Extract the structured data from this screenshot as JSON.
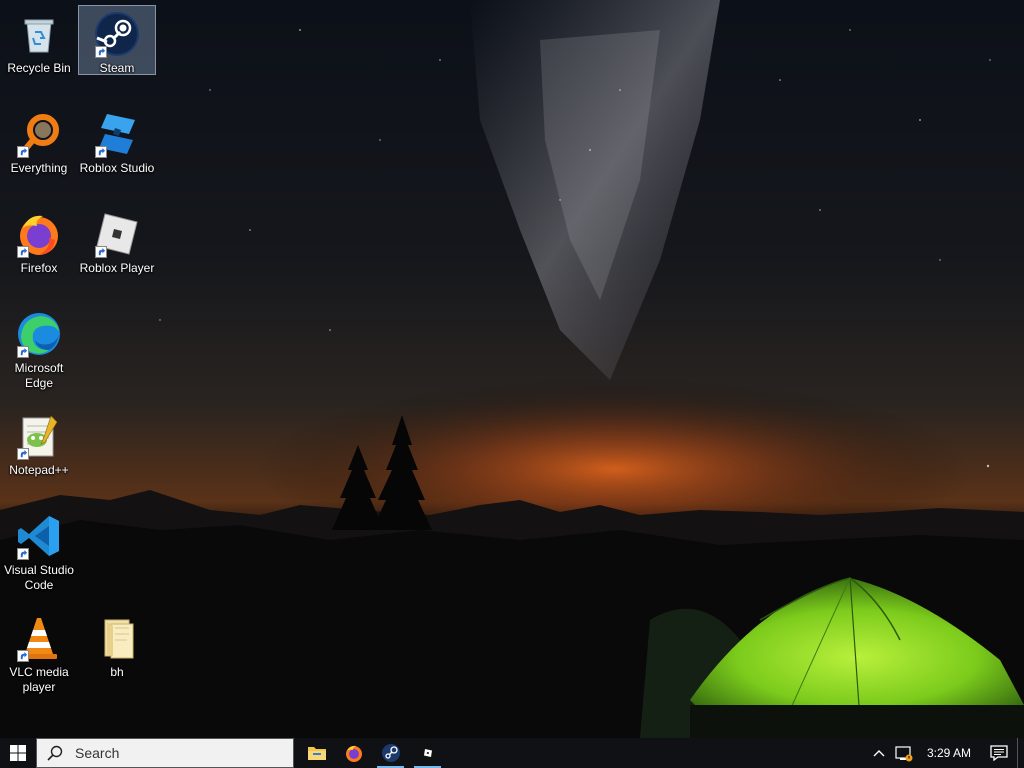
{
  "desktop": {
    "icons": [
      {
        "name": "recycle-bin",
        "label": "Recycle Bin",
        "selected": false,
        "shortcut": false
      },
      {
        "name": "steam",
        "label": "Steam",
        "selected": true,
        "shortcut": true
      },
      {
        "name": "everything",
        "label": "Everything",
        "selected": false,
        "shortcut": true
      },
      {
        "name": "roblox-studio",
        "label": "Roblox Studio",
        "selected": false,
        "shortcut": true
      },
      {
        "name": "firefox",
        "label": "Firefox",
        "selected": false,
        "shortcut": true
      },
      {
        "name": "roblox-player",
        "label": "Roblox Player",
        "selected": false,
        "shortcut": true
      },
      {
        "name": "microsoft-edge",
        "label": "Microsoft Edge",
        "selected": false,
        "shortcut": true
      },
      {
        "name": "notepad-plus-plus",
        "label": "Notepad++",
        "selected": false,
        "shortcut": true
      },
      {
        "name": "visual-studio-code",
        "label": "Visual Studio Code",
        "selected": false,
        "shortcut": true
      },
      {
        "name": "vlc-media-player",
        "label": "VLC media player",
        "selected": false,
        "shortcut": true
      },
      {
        "name": "bh-folder",
        "label": "bh",
        "selected": false,
        "shortcut": false
      }
    ]
  },
  "taskbar": {
    "search_placeholder": "Search",
    "pinned_apps": [
      "file-explorer",
      "firefox",
      "steam",
      "roblox"
    ],
    "running_apps": [
      "steam",
      "roblox"
    ],
    "clock": "3:29 AM"
  },
  "colors": {
    "taskbar_bg": "#101114",
    "running_indicator": "#76b9ed",
    "selection": "#a0bee6"
  }
}
